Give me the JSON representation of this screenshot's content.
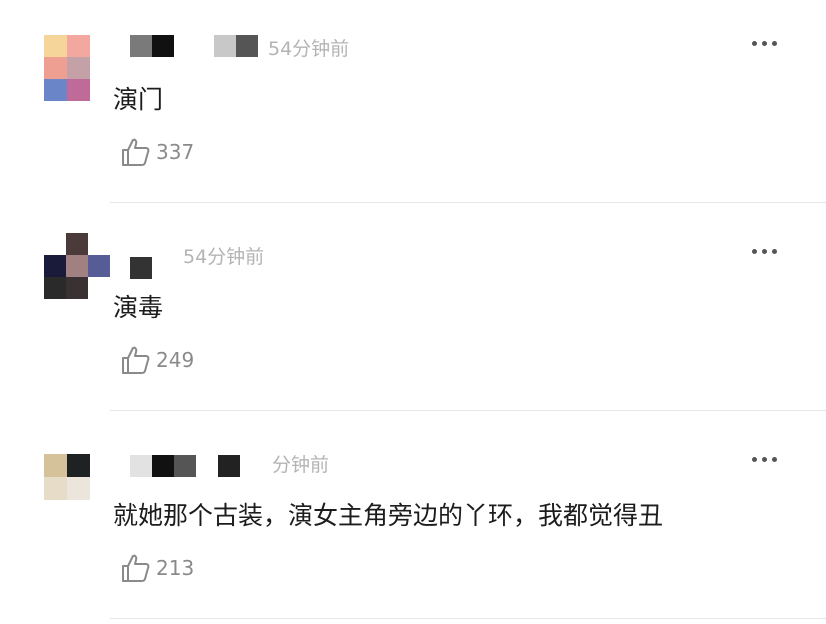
{
  "comments": [
    {
      "time": "54分钟前",
      "text": "演门",
      "likes": "337",
      "avatar_colors": [
        "#f6d59b",
        "#f2a79f",
        "#ee9f92",
        "#c3a1a7",
        "#6a86c8",
        "#c06a99"
      ]
    },
    {
      "time": "54分钟前",
      "text": "演毒",
      "likes": "249",
      "avatar_colors": [
        "#ffffff",
        "#4a3a3a",
        "#ffffff",
        "#1a1a3a",
        "#a08080",
        "#565c96",
        "#2a2a2a",
        "#3a3232",
        "#ffffff"
      ]
    },
    {
      "time": "分钟前",
      "text": "就她那个古装，演女主角旁边的丫环，我都觉得丑",
      "likes": "213",
      "avatar_colors": [
        "#d5c29a",
        "#1f2222",
        "#e6dcc8",
        "#ebe5dc"
      ]
    }
  ],
  "icons": {
    "like": "thumbs-up-icon",
    "more": "more-dots-icon"
  }
}
